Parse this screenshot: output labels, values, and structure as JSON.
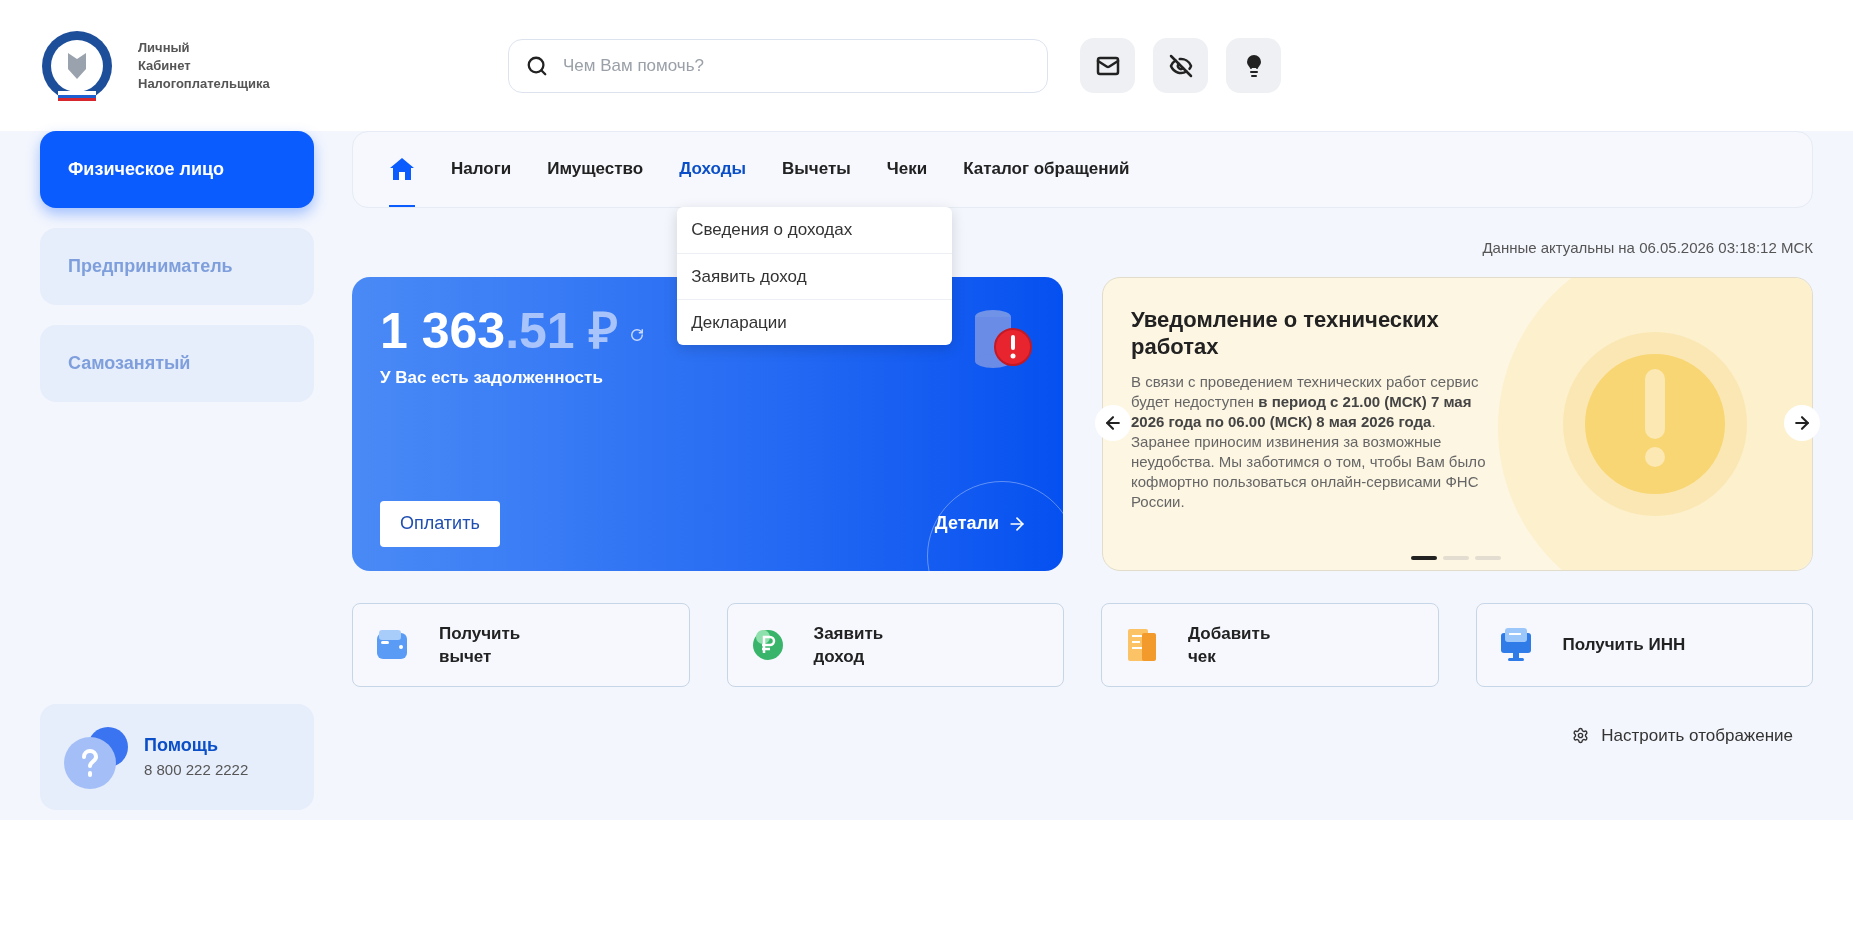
{
  "header": {
    "logo_lines": [
      "Личный",
      "Кабинет",
      "Налогоплательщика"
    ],
    "search": {
      "placeholder": "Чем Вам помочь?"
    }
  },
  "sidebar": {
    "items": [
      {
        "label": "Физическое лицо",
        "selected": true
      },
      {
        "label": "Предприниматель",
        "selected": false
      },
      {
        "label": "Самозанятый",
        "selected": false
      }
    ],
    "help": {
      "title": "Помощь",
      "phone": "8 800 222 2222"
    }
  },
  "nav": {
    "tabs": [
      {
        "kind": "home",
        "selected": true,
        "expanded": false
      },
      {
        "kind": "text",
        "label": "Налоги",
        "selected": false,
        "expanded": false
      },
      {
        "kind": "text",
        "label": "Имущество",
        "selected": false,
        "expanded": false
      },
      {
        "kind": "text",
        "label": "Доходы",
        "selected": false,
        "expanded": true
      },
      {
        "kind": "text",
        "label": "Вычеты",
        "selected": false,
        "expanded": false
      },
      {
        "kind": "text",
        "label": "Чеки",
        "selected": false,
        "expanded": false
      },
      {
        "kind": "text",
        "label": "Каталог обращений",
        "selected": false,
        "expanded": false
      }
    ],
    "dropdown": [
      "Сведения о доходах",
      "Заявить доход",
      "Декларации"
    ]
  },
  "date_note": "Данные актуальны на 06.05.2026 03:18:12 МСК",
  "debt": {
    "amount": "1 363",
    "fraction": ".51 ₽",
    "status": "У Вас есть задолженность",
    "pay_button": "Оплатить",
    "details_link": "Детали"
  },
  "notice": {
    "title": "Уведомление о технических работах",
    "body": "В связи с проведением технических работ сервис будет недоступен **в период с 21.00 (МСК) 7 мая 2026 года по 06.00 (МСК) 8 мая 2026 года**. Заранее приносим извинения за возможные неудобства. Мы заботимся о том, чтобы Вам было кофмортно пользоваться онлайн-сервисами ФНС России.",
    "slides": [
      {
        "selected": true
      },
      {
        "selected": false
      },
      {
        "selected": false
      }
    ]
  },
  "quick_actions": [
    {
      "kind": "wallet",
      "lines": [
        "Получить",
        "вычет"
      ]
    },
    {
      "kind": "ruble",
      "lines": [
        "Заявить",
        "доход"
      ]
    },
    {
      "kind": "receipt",
      "lines": [
        "Добавить",
        "чек"
      ]
    },
    {
      "kind": "monitor",
      "lines": [
        "Получить ИНН"
      ]
    }
  ],
  "settings_link": "Настроить отображение"
}
